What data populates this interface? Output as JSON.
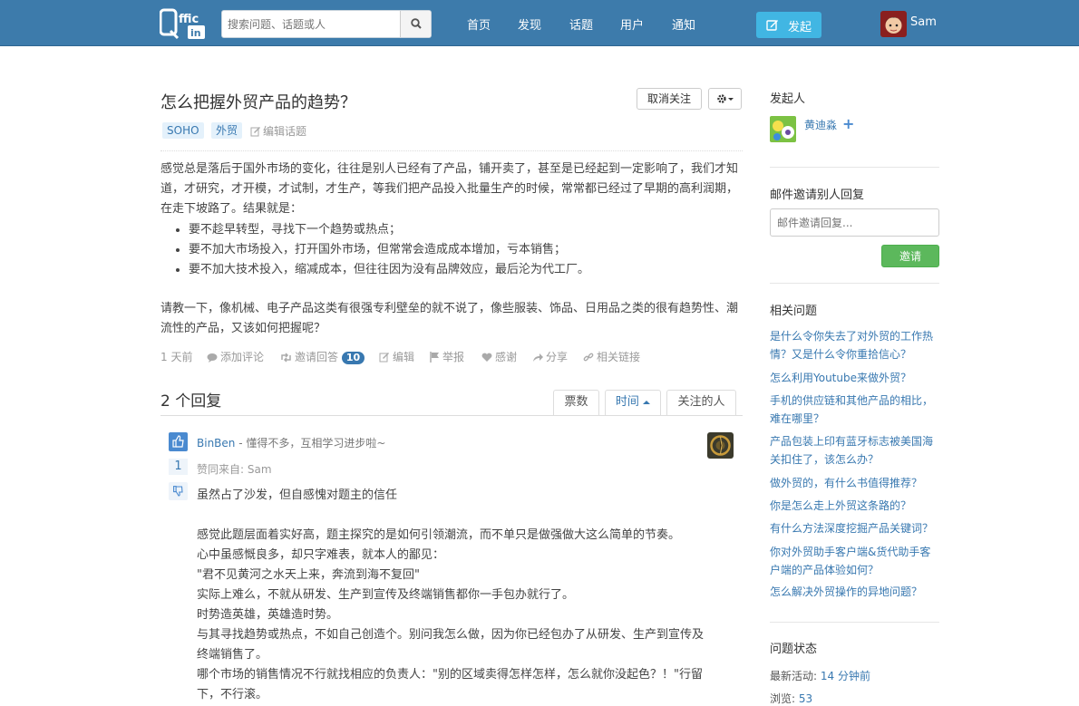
{
  "header": {
    "search_placeholder": "搜索问题、话题或人",
    "nav": [
      "首页",
      "发现",
      "话题",
      "用户",
      "通知"
    ],
    "post_label": "发起",
    "user_name": "Sam"
  },
  "question": {
    "title": "怎么把握外贸产品的趋势？",
    "unfollow_label": "取消关注",
    "tags": [
      "SOHO",
      "外贸"
    ],
    "edit_topic_label": "编辑话题",
    "intro_lines": [
      "感觉总是落后于国外市场的变化，往往是别人已经有了产品，铺开卖了，甚至是已经起到一定影响了，我们才知",
      "道，才研究，才开模，才试制，才生产，等我们把产品投入批量生产的时候，常常都已经过了早期的高利润期，",
      "在走下坡路了。结果就是："
    ],
    "bullets": [
      "要不趁早转型，寻找下一个趋势或热点；",
      "要不加大市场投入，打开国外市场，但常常会造成成本增加，亏本销售；",
      "要不加大技术投入，缩减成本，但往往因为没有品牌效应，最后沦为代工厂。"
    ],
    "ask_lines": [
      "请教一下，像机械、电子产品这类有很强专利壁垒的就不说了，像些服装、饰品、日用品之类的很有趋势性、潮",
      "流性的产品，又该如何把握呢？"
    ],
    "meta": {
      "time": "1 天前",
      "add_comment": "添加评论",
      "invite_answer": "邀请回答",
      "invite_count": "10",
      "edit": "编辑",
      "report": "举报",
      "thanks": "感谢",
      "share": "分享",
      "related_links": "相关链接"
    }
  },
  "answers": {
    "title": "2 个回复",
    "sort_tabs": [
      "票数",
      "时间",
      "关注的人"
    ],
    "first": {
      "user": "BinBen",
      "signature": " - 懂得不多，互相学习进步啦~",
      "votes": "1",
      "from": "赞同来自:  Sam",
      "lines": [
        "虽然占了沙发，但自感愧对题主的信任",
        "",
        "感觉此题层面着实好高，题主探究的是如何引领潮流，而不单只是做强做大这么简单的节奏。",
        "心中虽感慨良多，却只字难表，就本人的鄙见：",
        "\"君不见黄河之水天上来，奔流到海不复回\"",
        "实际上难么，不就从研发、生产到宣传及终端销售都你一手包办就行了。",
        "时势造英雄，英雄造时势。",
        "与其寻找趋势或热点，不如自己创造个。别问我怎么做，因为你已经包办了从研发、生产到宣传及",
        "终端销售了。",
        "哪个市场的销售情况不行就找相应的负责人：\"别的区域卖得怎样怎样，怎么就你没起色？！\"行留",
        "下，不行滚。"
      ]
    }
  },
  "sidebar": {
    "initiator_title": "发起人",
    "initiator_name": "黄迪淼",
    "invite_title": "邮件邀请别人回复",
    "invite_placeholder": "邮件邀请回复...",
    "invite_button": "邀请",
    "related_title": "相关问题",
    "related": [
      [
        "是什么令你失去了对外贸的工作热",
        "情？又是什么令你重拾信心？"
      ],
      [
        "怎么利用Youtube来做外贸？"
      ],
      [
        "手机的供应链和其他产品的相比，",
        "难在哪里？"
      ],
      [
        "产品包装上印有蓝牙标志被美国海",
        "关扣住了，该怎么办？"
      ],
      [
        "做外贸的，有什么书值得推荐？"
      ],
      [
        "你是怎么走上外贸这条路的？"
      ],
      [
        "有什么方法深度挖掘产品关键词？"
      ],
      [
        "你对外贸助手客户端&货代助手客",
        "户端的产品体验如何？"
      ],
      [
        "怎么解决外贸操作的异地问题？"
      ]
    ],
    "status_title": "问题状态",
    "last_active_label": "最新活动: ",
    "last_active_value": "14 分钟前",
    "views_label": "浏览: ",
    "views_value": "53"
  }
}
